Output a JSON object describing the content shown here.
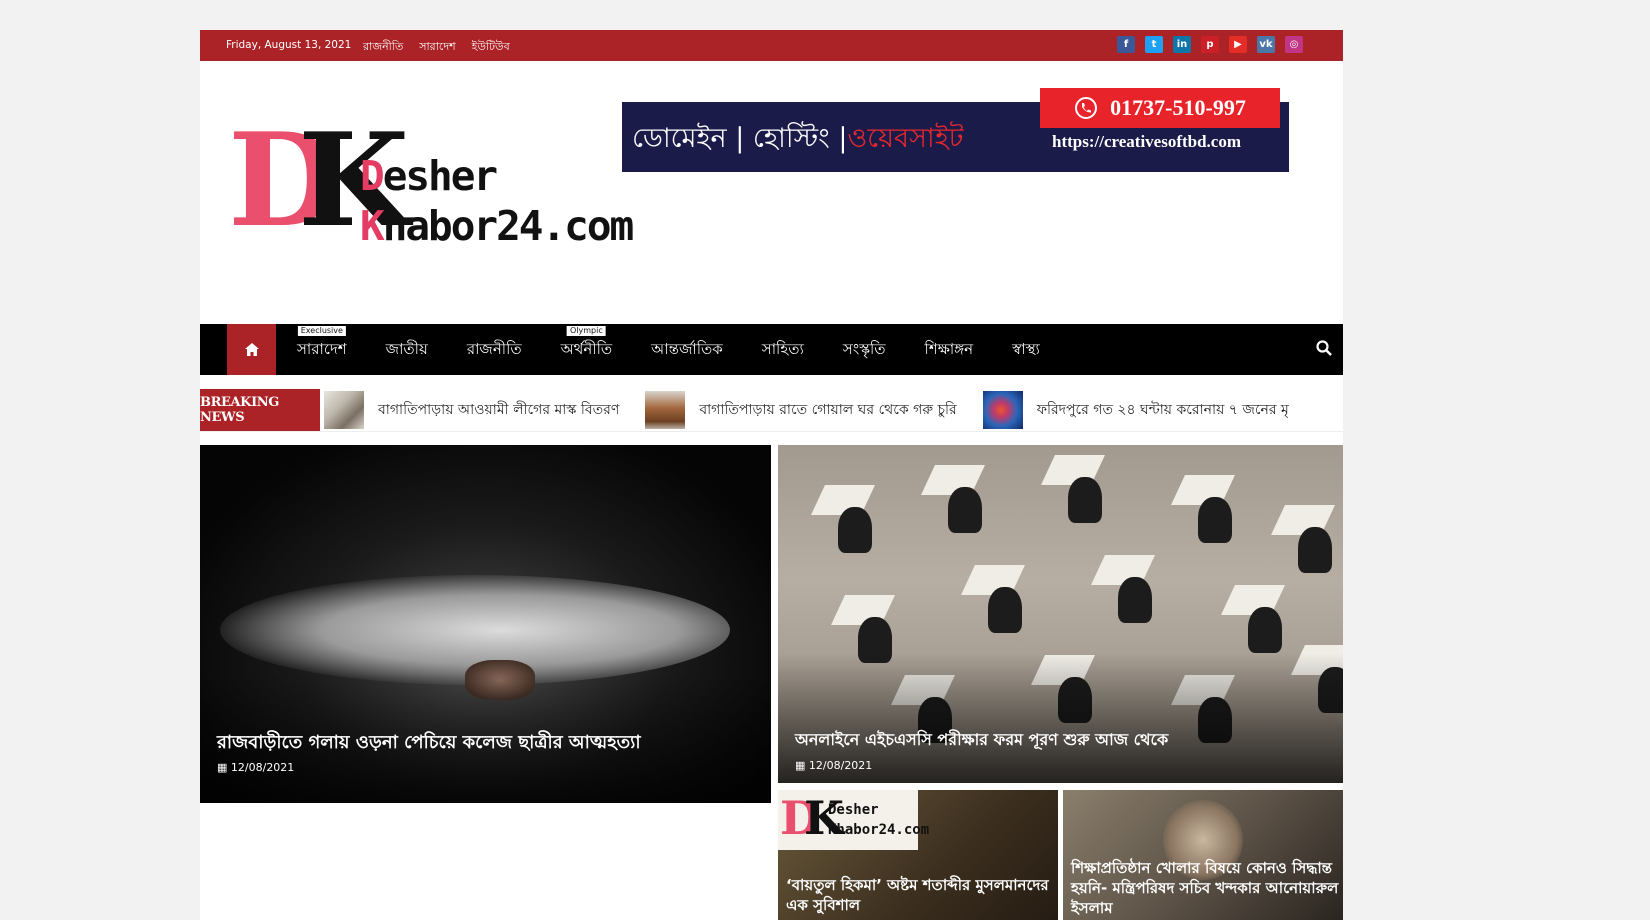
{
  "topbar": {
    "date": "Friday, August 13, 2021",
    "links": [
      "রাজনীতি",
      "সারাদেশ",
      "ইউটিউব"
    ],
    "social": [
      {
        "icon": "facebook-icon",
        "glyph": "f",
        "color": "#3b5998"
      },
      {
        "icon": "twitter-icon",
        "glyph": "t",
        "color": "#1da1f2"
      },
      {
        "icon": "linkedin-icon",
        "glyph": "in",
        "color": "#0e76a8"
      },
      {
        "icon": "pinterest-icon",
        "glyph": "p",
        "color": "#cb2027"
      },
      {
        "icon": "youtube-icon",
        "glyph": "▶",
        "color": "#e52d27"
      },
      {
        "icon": "vk-icon",
        "glyph": "vk",
        "color": "#4a76a8"
      },
      {
        "icon": "instagram-icon",
        "glyph": "◎",
        "color": "#c13584"
      }
    ]
  },
  "logo": {
    "d": "D",
    "k": "K",
    "word1_initial": "D",
    "word1_rest": "esher",
    "word2_initial": "K",
    "word2_rest": "habor24.com"
  },
  "banner": {
    "text_white": "ডোমেইন | হোস্টিং |",
    "text_red": "ওয়েবসাইট",
    "phone": "01737-510-997",
    "url": "https://creativesoftbd.com"
  },
  "nav": {
    "items": [
      {
        "label": "সারাদেশ",
        "tag": "Execlusive"
      },
      {
        "label": "জাতীয়",
        "tag": ""
      },
      {
        "label": "রাজনীতি",
        "tag": ""
      },
      {
        "label": "অর্থনীতি",
        "tag": "Olympic"
      },
      {
        "label": "আন্তর্জাতিক",
        "tag": ""
      },
      {
        "label": "সাহিত্য",
        "tag": ""
      },
      {
        "label": "সংস্কৃতি",
        "tag": ""
      },
      {
        "label": "শিক্ষাঙ্গন",
        "tag": ""
      },
      {
        "label": "স্বাস্থ্য",
        "tag": ""
      }
    ]
  },
  "breaking": {
    "label": "BREAKING NEWS",
    "items": [
      "বাগাতিপাড়ায় আওয়ামী লীগের মাস্ক বিতরণ",
      "বাগাতিপাড়ায় রাতে গোয়াল ঘর থেকে গরু চুরি",
      "ফরিদপুরে গত ২৪ ঘন্টায় করোনায় ৭ জনের মৃ"
    ]
  },
  "featured": {
    "left": {
      "title": "রাজবাড়ীতে গলায় ওড়না পেচিয়ে কলেজ ছাত্রীর আত্মহত্যা",
      "date": "12/08/2021"
    },
    "right": {
      "title": "অনলাইনে এইচএসসি পরীক্ষার ফরম পূরণ শুরু আজ থেকে",
      "date": "12/08/2021"
    },
    "small": [
      {
        "title": "‘বায়তুল হিকমা’ অষ্টম শতাব্দীর মুসলমানদের এক সুবিশাল"
      },
      {
        "title": "শিক্ষাপ্রতিষ্ঠান খোলার বিষয়ে কোনও সিদ্ধান্ত হয়নি- মন্ত্রিপরিষদ সচিব খন্দকার আনোয়ারুল ইসলাম"
      }
    ],
    "minilogo": {
      "word1": "Desher",
      "word2": "Khabor24.com"
    }
  }
}
